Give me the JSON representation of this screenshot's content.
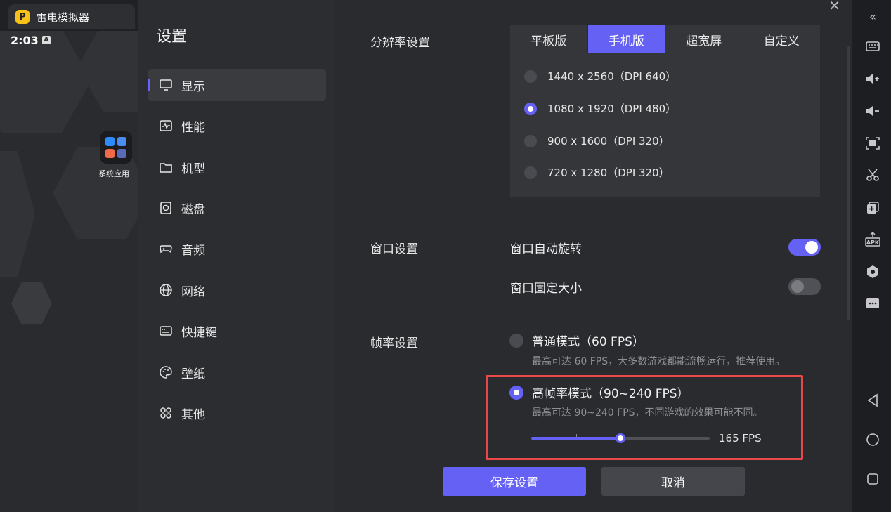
{
  "emulator": {
    "app_title": "雷电模拟器",
    "clock": "2:03",
    "clock_badge": "A",
    "system_app_label": "系统应用"
  },
  "nav": {
    "title": "设置",
    "items": [
      {
        "label": "显示",
        "icon": "monitor-icon",
        "active": true
      },
      {
        "label": "性能",
        "icon": "performance-icon",
        "active": false
      },
      {
        "label": "机型",
        "icon": "folder-icon",
        "active": false
      },
      {
        "label": "磁盘",
        "icon": "disk-icon",
        "active": false
      },
      {
        "label": "音频",
        "icon": "gamepad-icon",
        "active": false
      },
      {
        "label": "网络",
        "icon": "globe-icon",
        "active": false
      },
      {
        "label": "快捷键",
        "icon": "keyboard-icon",
        "active": false
      },
      {
        "label": "壁纸",
        "icon": "palette-icon",
        "active": false
      },
      {
        "label": "其他",
        "icon": "grid-icon",
        "active": false
      }
    ]
  },
  "resolution": {
    "label": "分辨率设置",
    "tabs": [
      {
        "label": "平板版",
        "selected": false
      },
      {
        "label": "手机版",
        "selected": true
      },
      {
        "label": "超宽屏",
        "selected": false
      },
      {
        "label": "自定义",
        "selected": false
      }
    ],
    "options": [
      {
        "label": "1440 x 2560（DPI 640）",
        "selected": false
      },
      {
        "label": "1080 x 1920（DPI 480）",
        "selected": true
      },
      {
        "label": "900 x 1600（DPI 320）",
        "selected": false
      },
      {
        "label": "720 x 1280（DPI 320）",
        "selected": false
      }
    ]
  },
  "window": {
    "label": "窗口设置",
    "auto_rotate": {
      "label": "窗口自动旋转",
      "on": true
    },
    "fixed_size": {
      "label": "窗口固定大小",
      "on": false
    }
  },
  "framerate": {
    "label": "帧率设置",
    "normal": {
      "label": "普通模式（60 FPS）",
      "desc": "最高可达 60 FPS，大多数游戏都能流畅运行，推荐使用。",
      "selected": false
    },
    "high": {
      "label": "高帧率模式（90~240 FPS）",
      "desc": "最高可达 90~240 FPS，不同游戏的效果可能不同。",
      "selected": true
    },
    "slider": {
      "min": 90,
      "max": 240,
      "value": 165,
      "value_label": "165 FPS"
    }
  },
  "buttons": {
    "save": "保存设置",
    "cancel": "取消"
  },
  "toolbar": {
    "icons": [
      "collapse-icon",
      "keyboard-icon",
      "volume-up-icon",
      "volume-down-icon",
      "screenshot-icon",
      "scissors-icon",
      "add-window-icon",
      "apk-install-icon",
      "settings-hex-icon",
      "more-icon",
      "back-icon",
      "home-icon",
      "recents-icon"
    ]
  },
  "colors": {
    "accent": "#6561f5",
    "highlight": "#e84848"
  }
}
